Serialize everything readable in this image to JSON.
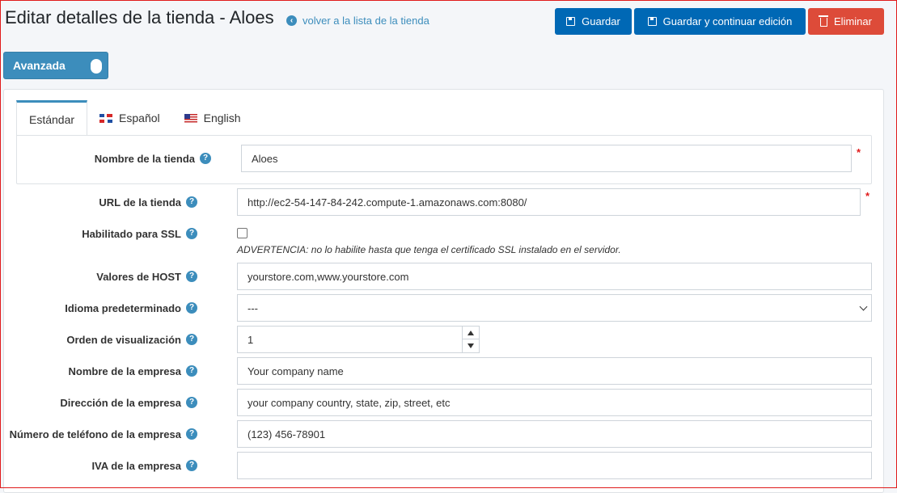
{
  "header": {
    "title": "Editar detalles de la tienda - Aloes",
    "back_link": "volver a la lista de la tienda",
    "save_label": "Guardar",
    "save_continue_label": "Guardar y continuar edición",
    "delete_label": "Eliminar"
  },
  "advanced_toggle": {
    "label": "Avanzada",
    "on": true
  },
  "tabs": [
    {
      "label": "Estándar",
      "active": true
    },
    {
      "label": "Español",
      "flag": "flag-es-icon"
    },
    {
      "label": "English",
      "flag": "flag-us-icon"
    }
  ],
  "form": {
    "store_name": {
      "label": "Nombre de la tienda",
      "value": "Aloes",
      "required": "*"
    },
    "store_url": {
      "label": "URL de la tienda",
      "value": "http://ec2-54-147-84-242.compute-1.amazonaws.com:8080/",
      "required": "*"
    },
    "ssl": {
      "label": "Habilitado para SSL",
      "checked": false,
      "warning": "ADVERTENCIA: no lo habilite hasta que tenga el certificado SSL instalado en el servidor."
    },
    "host_values": {
      "label": "Valores de HOST",
      "value": "yourstore.com,www.yourstore.com"
    },
    "default_language": {
      "label": "Idioma predeterminado",
      "value": "---"
    },
    "display_order": {
      "label": "Orden de visualización",
      "value": "1"
    },
    "company_name": {
      "label": "Nombre de la empresa",
      "value": "Your company name"
    },
    "company_address": {
      "label": "Dirección de la empresa",
      "value": "your company country, state, zip, street, etc"
    },
    "company_phone": {
      "label": "Número de teléfono de la empresa",
      "value": "(123) 456-78901"
    },
    "company_vat": {
      "label": "IVA de la empresa",
      "value": ""
    }
  },
  "colors": {
    "primary": "#0068b5",
    "danger": "#dd4b39",
    "accent": "#3c8dbc",
    "required": "#e01b1b"
  }
}
